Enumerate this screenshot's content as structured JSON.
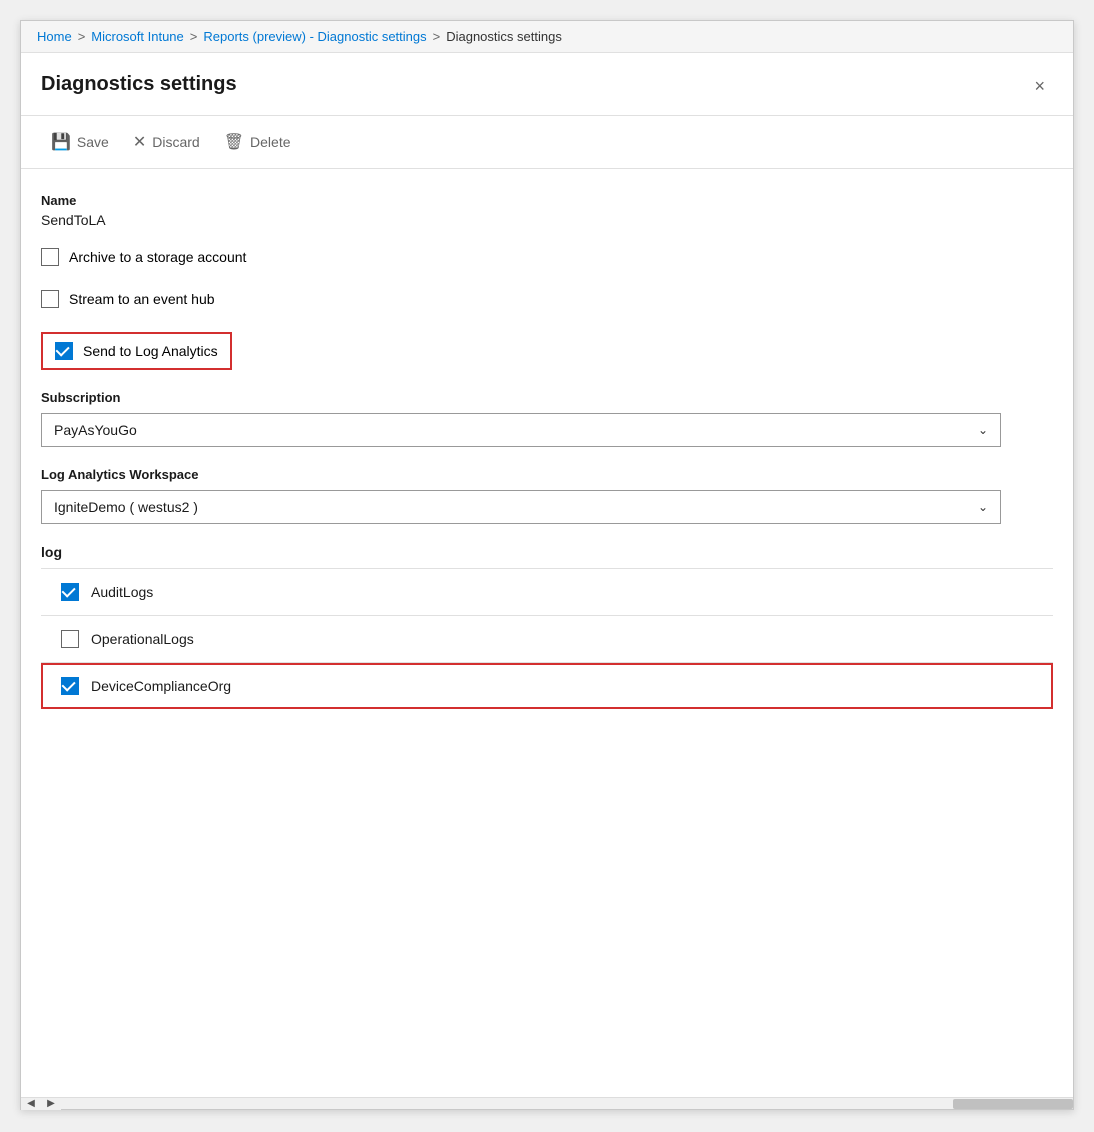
{
  "breadcrumb": {
    "items": [
      {
        "label": "Home",
        "active": true
      },
      {
        "label": "Microsoft Intune",
        "active": true
      },
      {
        "label": "Reports (preview) - Diagnostic settings",
        "active": true
      },
      {
        "label": "Diagnostics settings",
        "active": false
      }
    ],
    "separators": [
      ">",
      ">",
      ">"
    ]
  },
  "panel": {
    "title": "Diagnostics settings",
    "close_label": "×"
  },
  "toolbar": {
    "save_label": "Save",
    "discard_label": "Discard",
    "delete_label": "Delete"
  },
  "form": {
    "name_label": "Name",
    "name_value": "SendToLA",
    "archive_label": "Archive to a storage account",
    "stream_label": "Stream to an event hub",
    "send_to_la_label": "Send to Log Analytics",
    "subscription_label": "Subscription",
    "subscription_value": "PayAsYouGo",
    "workspace_label": "Log Analytics Workspace",
    "workspace_value": "IgniteDemo ( westus2 )",
    "log_section_label": "log",
    "log_items": [
      {
        "label": "AuditLogs",
        "checked": true,
        "highlighted": false
      },
      {
        "label": "OperationalLogs",
        "checked": false,
        "highlighted": false
      },
      {
        "label": "DeviceComplianceOrg",
        "checked": true,
        "highlighted": true
      }
    ]
  }
}
